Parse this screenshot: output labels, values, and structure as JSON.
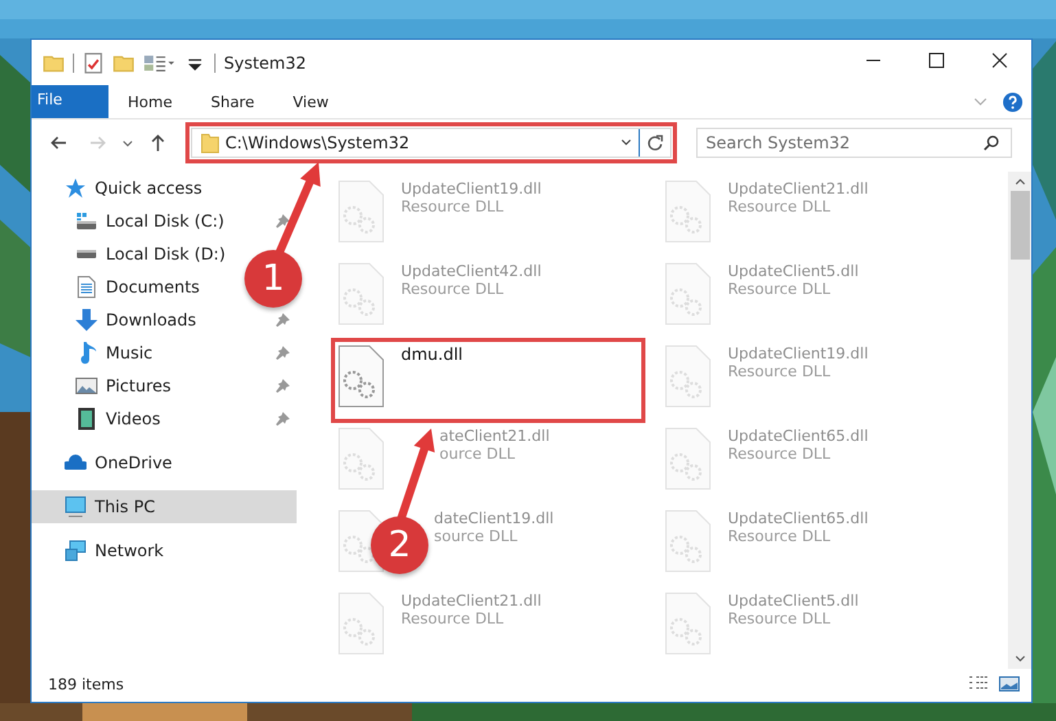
{
  "window": {
    "title": "System32"
  },
  "ribbon_tabs": [
    {
      "label": "File",
      "kind": "file"
    },
    {
      "label": "Home",
      "kind": "tab"
    },
    {
      "label": "Share",
      "kind": "tab"
    },
    {
      "label": "View",
      "kind": "tab"
    }
  ],
  "address": {
    "path": "C:\\Windows\\System32",
    "highlighted": true
  },
  "search": {
    "placeholder": "Search System32"
  },
  "navigation": [
    {
      "label": "Quick access",
      "kind": "star",
      "selected": false,
      "children": [
        {
          "label": "Local Disk (C:)",
          "kind": "windrive",
          "pinned": true,
          "selected": false
        },
        {
          "label": "Local Disk (D:)",
          "kind": "drive",
          "pinned": false,
          "selected": false
        },
        {
          "label": "Documents",
          "kind": "doc",
          "pinned": false,
          "selected": false
        },
        {
          "label": "Downloads",
          "kind": "download",
          "pinned": true,
          "selected": false
        },
        {
          "label": "Music",
          "kind": "music",
          "pinned": true,
          "selected": false
        },
        {
          "label": "Pictures",
          "kind": "picture",
          "pinned": true,
          "selected": false
        },
        {
          "label": "Videos",
          "kind": "video",
          "pinned": true,
          "selected": false
        }
      ]
    },
    {
      "label": "OneDrive",
      "kind": "cloud",
      "selected": false
    },
    {
      "label": "This PC",
      "kind": "pc",
      "selected": true
    },
    {
      "label": "Network",
      "kind": "network",
      "selected": false
    }
  ],
  "files": [
    {
      "name": "UpdateClient19.dll",
      "type": "Resource DLL",
      "faded": true,
      "highlighted": false
    },
    {
      "name": "UpdateClient21.dll",
      "type": "Resource DLL",
      "faded": true,
      "highlighted": false
    },
    {
      "name": "UpdateClient42.dll",
      "type": "Resource DLL",
      "faded": true,
      "highlighted": false
    },
    {
      "name": "UpdateClient5.dll",
      "type": "Resource DLL",
      "faded": true,
      "highlighted": false
    },
    {
      "name": "dmu.dll",
      "faded": false,
      "highlighted": true
    },
    {
      "name": "UpdateClient19.dll",
      "type": "Resource DLL",
      "faded": true,
      "highlighted": false
    },
    {
      "name": "ateClient21.dll",
      "type": "ource DLL",
      "faded": true,
      "highlighted": false
    },
    {
      "name": "UpdateClient65.dll",
      "type": "Resource DLL",
      "faded": true,
      "highlighted": false
    },
    {
      "name": "dateClient19.dll",
      "type": "source DLL",
      "faded": true,
      "highlighted": false
    },
    {
      "name": "UpdateClient65.dll",
      "type": "Resource DLL",
      "faded": true,
      "highlighted": false
    },
    {
      "name": "UpdateClient21.dll",
      "type": "Resource DLL",
      "faded": true,
      "highlighted": false
    },
    {
      "name": "UpdateClient5.dll",
      "type": "Resource DLL",
      "faded": true,
      "highlighted": false
    }
  ],
  "status_bar": {
    "count": "189 items"
  },
  "annotations": [
    {
      "number": "1"
    },
    {
      "number": "2"
    }
  ]
}
